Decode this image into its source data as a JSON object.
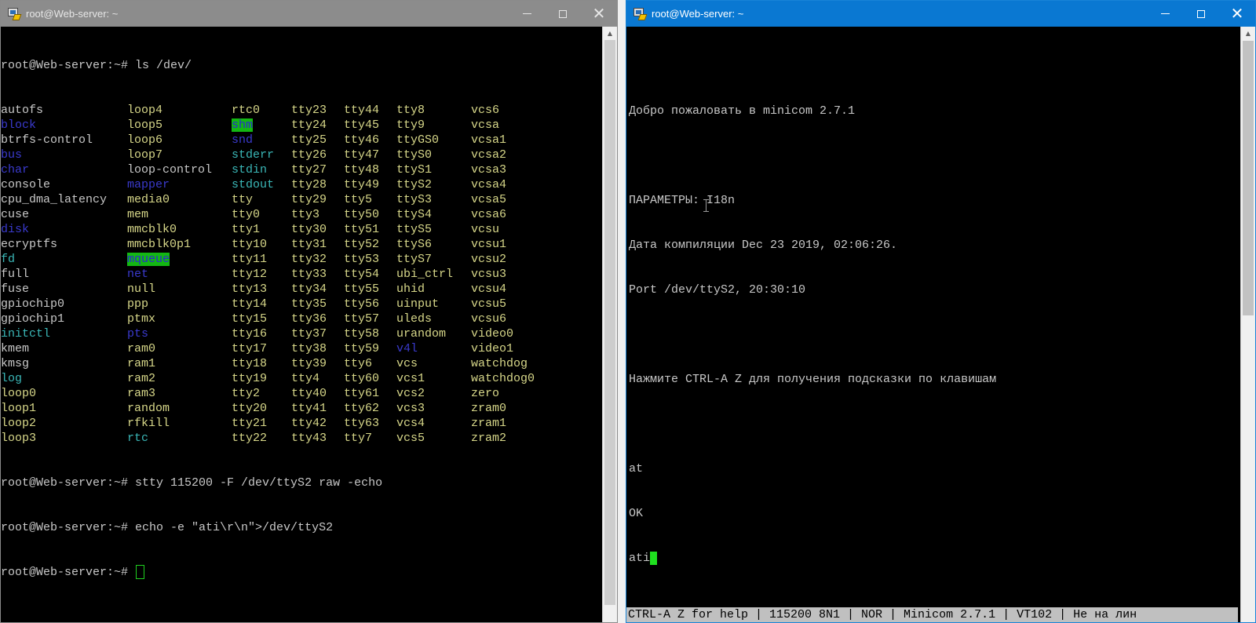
{
  "left_window": {
    "title": "root@Web-server: ~",
    "prompt_ls": "root@Web-server:~# ls /dev/",
    "ls_rows": [
      [
        {
          "t": "autofs",
          "k": "f"
        },
        {
          "t": "loop4",
          "k": "dev"
        },
        {
          "t": "rtc0",
          "k": "dev"
        },
        {
          "t": "tty23",
          "k": "dev"
        },
        {
          "t": "tty44",
          "k": "dev"
        },
        {
          "t": "tty8",
          "k": "dev"
        },
        {
          "t": "vcs6",
          "k": "dev"
        }
      ],
      [
        {
          "t": "block",
          "k": "dir"
        },
        {
          "t": "loop5",
          "k": "dev"
        },
        {
          "t": "shm",
          "k": "hl"
        },
        {
          "t": "tty24",
          "k": "dev"
        },
        {
          "t": "tty45",
          "k": "dev"
        },
        {
          "t": "tty9",
          "k": "dev"
        },
        {
          "t": "vcsa",
          "k": "dev"
        }
      ],
      [
        {
          "t": "btrfs-control",
          "k": "f"
        },
        {
          "t": "loop6",
          "k": "dev"
        },
        {
          "t": "snd",
          "k": "dir"
        },
        {
          "t": "tty25",
          "k": "dev"
        },
        {
          "t": "tty46",
          "k": "dev"
        },
        {
          "t": "ttyGS0",
          "k": "dev"
        },
        {
          "t": "vcsa1",
          "k": "dev"
        }
      ],
      [
        {
          "t": "bus",
          "k": "dir"
        },
        {
          "t": "loop7",
          "k": "dev"
        },
        {
          "t": "stderr",
          "k": "link"
        },
        {
          "t": "tty26",
          "k": "dev"
        },
        {
          "t": "tty47",
          "k": "dev"
        },
        {
          "t": "ttyS0",
          "k": "dev"
        },
        {
          "t": "vcsa2",
          "k": "dev"
        }
      ],
      [
        {
          "t": "char",
          "k": "dir"
        },
        {
          "t": "loop-control",
          "k": "f"
        },
        {
          "t": "stdin",
          "k": "link"
        },
        {
          "t": "tty27",
          "k": "dev"
        },
        {
          "t": "tty48",
          "k": "dev"
        },
        {
          "t": "ttyS1",
          "k": "dev"
        },
        {
          "t": "vcsa3",
          "k": "dev"
        }
      ],
      [
        {
          "t": "console",
          "k": "f"
        },
        {
          "t": "mapper",
          "k": "dir"
        },
        {
          "t": "stdout",
          "k": "link"
        },
        {
          "t": "tty28",
          "k": "dev"
        },
        {
          "t": "tty49",
          "k": "dev"
        },
        {
          "t": "ttyS2",
          "k": "dev"
        },
        {
          "t": "vcsa4",
          "k": "dev"
        }
      ],
      [
        {
          "t": "cpu_dma_latency",
          "k": "f"
        },
        {
          "t": "media0",
          "k": "dev"
        },
        {
          "t": "tty",
          "k": "dev"
        },
        {
          "t": "tty29",
          "k": "dev"
        },
        {
          "t": "tty5",
          "k": "dev"
        },
        {
          "t": "ttyS3",
          "k": "dev"
        },
        {
          "t": "vcsa5",
          "k": "dev"
        }
      ],
      [
        {
          "t": "cuse",
          "k": "f"
        },
        {
          "t": "mem",
          "k": "dev"
        },
        {
          "t": "tty0",
          "k": "dev"
        },
        {
          "t": "tty3",
          "k": "dev"
        },
        {
          "t": "tty50",
          "k": "dev"
        },
        {
          "t": "ttyS4",
          "k": "dev"
        },
        {
          "t": "vcsa6",
          "k": "dev"
        }
      ],
      [
        {
          "t": "disk",
          "k": "dir"
        },
        {
          "t": "mmcblk0",
          "k": "dev"
        },
        {
          "t": "tty1",
          "k": "dev"
        },
        {
          "t": "tty30",
          "k": "dev"
        },
        {
          "t": "tty51",
          "k": "dev"
        },
        {
          "t": "ttyS5",
          "k": "dev"
        },
        {
          "t": "vcsu",
          "k": "dev"
        }
      ],
      [
        {
          "t": "ecryptfs",
          "k": "f"
        },
        {
          "t": "mmcblk0p1",
          "k": "dev"
        },
        {
          "t": "tty10",
          "k": "dev"
        },
        {
          "t": "tty31",
          "k": "dev"
        },
        {
          "t": "tty52",
          "k": "dev"
        },
        {
          "t": "ttyS6",
          "k": "dev"
        },
        {
          "t": "vcsu1",
          "k": "dev"
        }
      ],
      [
        {
          "t": "fd",
          "k": "link"
        },
        {
          "t": "mqueue",
          "k": "hl"
        },
        {
          "t": "tty11",
          "k": "dev"
        },
        {
          "t": "tty32",
          "k": "dev"
        },
        {
          "t": "tty53",
          "k": "dev"
        },
        {
          "t": "ttyS7",
          "k": "dev"
        },
        {
          "t": "vcsu2",
          "k": "dev"
        }
      ],
      [
        {
          "t": "full",
          "k": "f"
        },
        {
          "t": "net",
          "k": "dir"
        },
        {
          "t": "tty12",
          "k": "dev"
        },
        {
          "t": "tty33",
          "k": "dev"
        },
        {
          "t": "tty54",
          "k": "dev"
        },
        {
          "t": "ubi_ctrl",
          "k": "dev"
        },
        {
          "t": "vcsu3",
          "k": "dev"
        }
      ],
      [
        {
          "t": "fuse",
          "k": "f"
        },
        {
          "t": "null",
          "k": "dev"
        },
        {
          "t": "tty13",
          "k": "dev"
        },
        {
          "t": "tty34",
          "k": "dev"
        },
        {
          "t": "tty55",
          "k": "dev"
        },
        {
          "t": "uhid",
          "k": "dev"
        },
        {
          "t": "vcsu4",
          "k": "dev"
        }
      ],
      [
        {
          "t": "gpiochip0",
          "k": "f"
        },
        {
          "t": "ppp",
          "k": "dev"
        },
        {
          "t": "tty14",
          "k": "dev"
        },
        {
          "t": "tty35",
          "k": "dev"
        },
        {
          "t": "tty56",
          "k": "dev"
        },
        {
          "t": "uinput",
          "k": "dev"
        },
        {
          "t": "vcsu5",
          "k": "dev"
        }
      ],
      [
        {
          "t": "gpiochip1",
          "k": "f"
        },
        {
          "t": "ptmx",
          "k": "dev"
        },
        {
          "t": "tty15",
          "k": "dev"
        },
        {
          "t": "tty36",
          "k": "dev"
        },
        {
          "t": "tty57",
          "k": "dev"
        },
        {
          "t": "uleds",
          "k": "dev"
        },
        {
          "t": "vcsu6",
          "k": "dev"
        }
      ],
      [
        {
          "t": "initctl",
          "k": "link"
        },
        {
          "t": "pts",
          "k": "dir"
        },
        {
          "t": "tty16",
          "k": "dev"
        },
        {
          "t": "tty37",
          "k": "dev"
        },
        {
          "t": "tty58",
          "k": "dev"
        },
        {
          "t": "urandom",
          "k": "dev"
        },
        {
          "t": "video0",
          "k": "dev"
        }
      ],
      [
        {
          "t": "kmem",
          "k": "f"
        },
        {
          "t": "ram0",
          "k": "dev"
        },
        {
          "t": "tty17",
          "k": "dev"
        },
        {
          "t": "tty38",
          "k": "dev"
        },
        {
          "t": "tty59",
          "k": "dev"
        },
        {
          "t": "v4l",
          "k": "dir"
        },
        {
          "t": "video1",
          "k": "dev"
        }
      ],
      [
        {
          "t": "kmsg",
          "k": "f"
        },
        {
          "t": "ram1",
          "k": "dev"
        },
        {
          "t": "tty18",
          "k": "dev"
        },
        {
          "t": "tty39",
          "k": "dev"
        },
        {
          "t": "tty6",
          "k": "dev"
        },
        {
          "t": "vcs",
          "k": "dev"
        },
        {
          "t": "watchdog",
          "k": "dev"
        }
      ],
      [
        {
          "t": "log",
          "k": "link"
        },
        {
          "t": "ram2",
          "k": "dev"
        },
        {
          "t": "tty19",
          "k": "dev"
        },
        {
          "t": "tty4",
          "k": "dev"
        },
        {
          "t": "tty60",
          "k": "dev"
        },
        {
          "t": "vcs1",
          "k": "dev"
        },
        {
          "t": "watchdog0",
          "k": "dev"
        }
      ],
      [
        {
          "t": "loop0",
          "k": "dev"
        },
        {
          "t": "ram3",
          "k": "dev"
        },
        {
          "t": "tty2",
          "k": "dev"
        },
        {
          "t": "tty40",
          "k": "dev"
        },
        {
          "t": "tty61",
          "k": "dev"
        },
        {
          "t": "vcs2",
          "k": "dev"
        },
        {
          "t": "zero",
          "k": "dev"
        }
      ],
      [
        {
          "t": "loop1",
          "k": "dev"
        },
        {
          "t": "random",
          "k": "dev"
        },
        {
          "t": "tty20",
          "k": "dev"
        },
        {
          "t": "tty41",
          "k": "dev"
        },
        {
          "t": "tty62",
          "k": "dev"
        },
        {
          "t": "vcs3",
          "k": "dev"
        },
        {
          "t": "zram0",
          "k": "dev"
        }
      ],
      [
        {
          "t": "loop2",
          "k": "dev"
        },
        {
          "t": "rfkill",
          "k": "dev"
        },
        {
          "t": "tty21",
          "k": "dev"
        },
        {
          "t": "tty42",
          "k": "dev"
        },
        {
          "t": "tty63",
          "k": "dev"
        },
        {
          "t": "vcs4",
          "k": "dev"
        },
        {
          "t": "zram1",
          "k": "dev"
        }
      ],
      [
        {
          "t": "loop3",
          "k": "dev"
        },
        {
          "t": "rtc",
          "k": "link"
        },
        {
          "t": "tty22",
          "k": "dev"
        },
        {
          "t": "tty43",
          "k": "dev"
        },
        {
          "t": "tty7",
          "k": "dev"
        },
        {
          "t": "vcs5",
          "k": "dev"
        },
        {
          "t": "zram2",
          "k": "dev"
        }
      ]
    ],
    "cmd_stty": "root@Web-server:~# stty 115200 -F /dev/ttyS2 raw -echo",
    "cmd_echo": "root@Web-server:~# echo -e \"ati\\r\\n\">/dev/ttyS2",
    "prompt_last": "root@Web-server:~# "
  },
  "right_window": {
    "title": "root@Web-server: ~",
    "welcome": "Добро пожаловать в minicom 2.7.1",
    "params": "ПАРАМЕТРЫ: I18n",
    "compiled": "Дата компиляции Dec 23 2019, 02:06:26.",
    "port": "Port /dev/ttyS2, 20:30:10",
    "hint": "Нажмите CTRL-A Z для получения подсказки по клавишам",
    "line_at": "at",
    "line_ok": "OK",
    "line_ati": "ati",
    "status_bar": "CTRL-A Z for help | 115200 8N1 | NOR | Minicom 2.7.1 | VT102 | Не на лин"
  },
  "colors": {
    "dir": "#3a3acd",
    "dev": "#d7d789",
    "link": "#3ab7b7",
    "highlight_bg": "#13b713",
    "active_titlebar": "#0a78d2",
    "inactive_titlebar": "#8c8c8c"
  },
  "icons": {
    "app": "putty-icon",
    "minimize": "minimize-icon",
    "maximize": "maximize-icon",
    "close": "close-icon"
  }
}
